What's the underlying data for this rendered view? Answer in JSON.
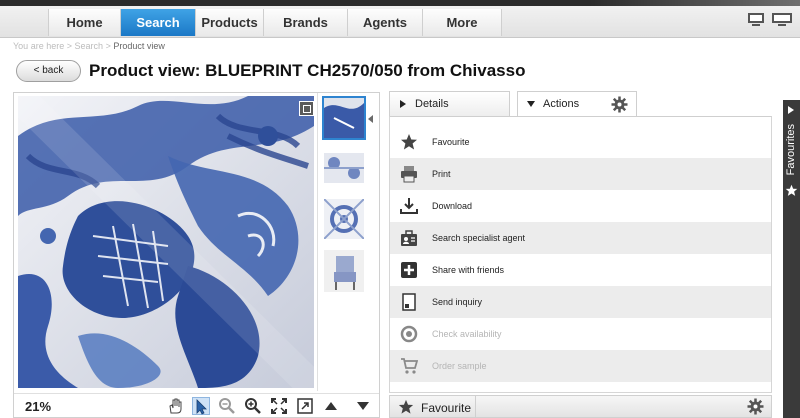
{
  "nav": {
    "items": [
      {
        "label": "Home"
      },
      {
        "label": "Search"
      },
      {
        "label": "Products"
      },
      {
        "label": "Brands"
      },
      {
        "label": "Agents"
      },
      {
        "label": "More"
      }
    ],
    "active": "Search"
  },
  "breadcrumb": {
    "items": [
      "You are here",
      "Search",
      "Product view"
    ],
    "separator": ">"
  },
  "header": {
    "back_label": "< back",
    "title": "Product view: BLUEPRINT CH2570/050 from Chivasso"
  },
  "viewer": {
    "zoom": "21%",
    "tools": [
      "hand-icon",
      "pointer-icon",
      "zoom-out-icon",
      "zoom-in-icon",
      "fit-icon",
      "fullscreen-icon",
      "arrow-up-icon",
      "arrow-down-icon"
    ],
    "thumbnail_count": 4
  },
  "tabs": {
    "details": "Details",
    "actions": "Actions"
  },
  "actions": [
    {
      "label": "Favourite",
      "icon": "star-icon",
      "enabled": true
    },
    {
      "label": "Print",
      "icon": "printer-icon",
      "enabled": true
    },
    {
      "label": "Download",
      "icon": "download-icon",
      "enabled": true
    },
    {
      "label": "Search specialist agent",
      "icon": "agent-icon",
      "enabled": true
    },
    {
      "label": "Share with friends",
      "icon": "plus-icon",
      "enabled": true
    },
    {
      "label": "Send inquiry",
      "icon": "inquiry-icon",
      "enabled": true
    },
    {
      "label": "Check availability",
      "icon": "availability-icon",
      "enabled": false
    },
    {
      "label": "Order sample",
      "icon": "cart-icon",
      "enabled": false
    }
  ],
  "bottom_bar": {
    "favourite_label": "Favourite"
  },
  "sidebar": {
    "label": "Favourites"
  },
  "colors": {
    "accent": "#1b78c6",
    "fabric_blue": "#2f4f9a",
    "fabric_light": "#eef0f5"
  }
}
